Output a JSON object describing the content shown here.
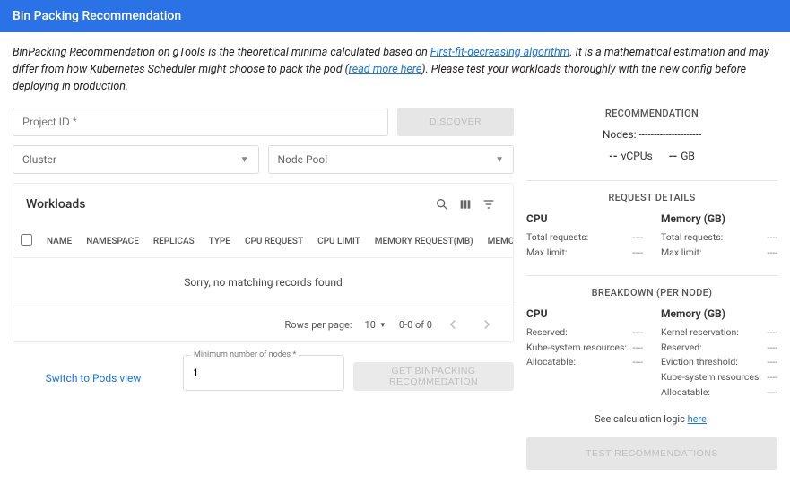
{
  "header": {
    "title": "Bin Packing Recommendation"
  },
  "intro": {
    "pre": "BinPacking Recommendation on gTools is the theoretical minima calculated based on ",
    "link1": "First-fit-decreasing algorithm",
    "mid": ". It is a mathematical estimation and may differ from how Kubernetes Scheduler might choose to pack the pod (",
    "link2": "read more here",
    "post": "). Please test your workloads thoroughly with the new config before deploying in production."
  },
  "form": {
    "project_label": "Project ID *",
    "cluster_label": "Cluster",
    "nodepool_label": "Node Pool",
    "discover": "Discover"
  },
  "workloads": {
    "title": "Workloads",
    "headers": {
      "name": "Name",
      "namespace": "Namespace",
      "replicas": "Replicas",
      "type": "Type",
      "cpu_request": "CPU Request",
      "cpu_limit": "CPU Limit",
      "mem_request": "Memory Request(MB)",
      "mem_limit": "Memory Limit(MB)"
    },
    "empty": "Sorry, no matching records found",
    "footer": {
      "rpp_label": "Rows per page:",
      "rpp_value": "10",
      "range": "0-0 of 0"
    }
  },
  "actions": {
    "switch_link": "Switch to Pods view",
    "min_nodes_label": "Minimum number of nodes *",
    "min_nodes_value": "1",
    "get_rec": "Get Binpacking Recommedation"
  },
  "recommendation": {
    "title": "Recommendation",
    "nodes_label": "Nodes:",
    "nodes_value": "---------------------",
    "vcpus_val": "--",
    "vcpus_label": "vCPUs",
    "gb_val": "--",
    "gb_label": "GB"
  },
  "request_details": {
    "title": "Request Details",
    "cpu_h": "CPU",
    "mem_h": "Memory (GB)",
    "total_requests": "Total requests:",
    "max_limit": "Max limit:",
    "dash": "----"
  },
  "breakdown": {
    "title": "Breakdown (per node)",
    "cpu_h": "CPU",
    "mem_h": "Memory (GB)",
    "cpu": {
      "reserved": "Reserved:",
      "kube_system": "Kube-system resources:",
      "allocatable": "Allocatable:"
    },
    "mem": {
      "kernel": "Kernel reservation:",
      "reserved": "Reserved:",
      "eviction": "Eviction threshold:",
      "kube_system": "Kube-system resources:",
      "allocatable": "Allocatable:"
    },
    "dash": "----"
  },
  "calc": {
    "pre": "See calculation logic ",
    "link": "here",
    "post": "."
  },
  "test_btn": "Test Recommendations"
}
